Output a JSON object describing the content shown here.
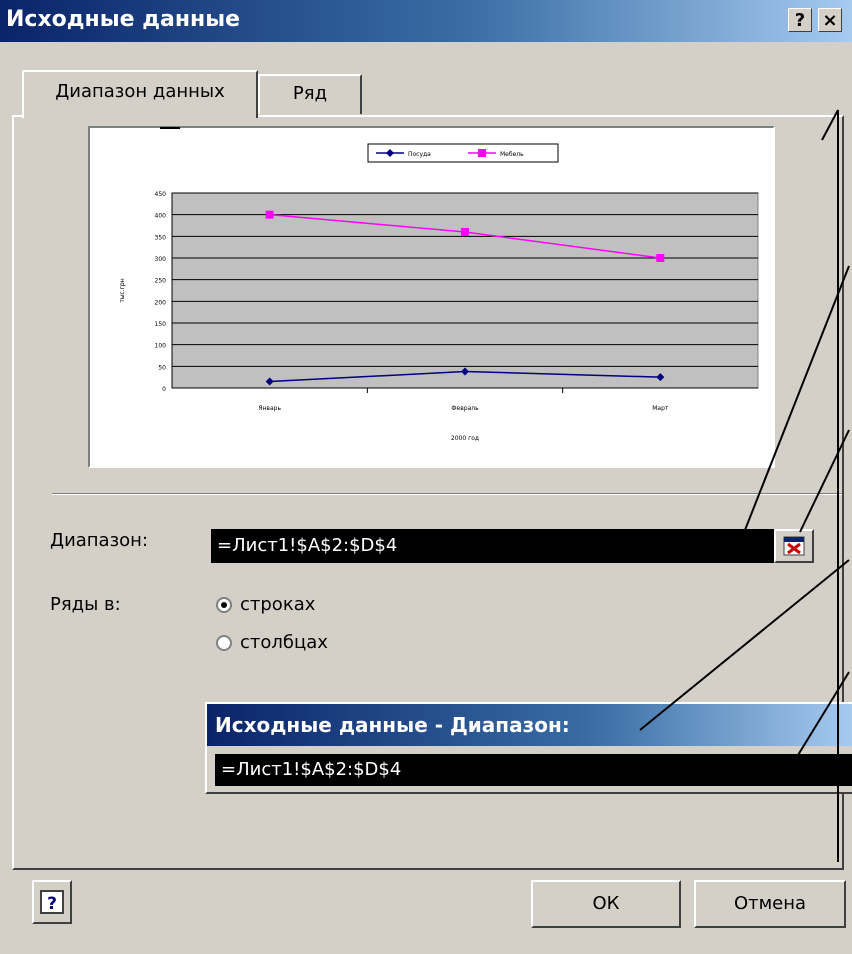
{
  "dialog": {
    "title": "Исходные данные",
    "help_btn": "?",
    "close_btn": "×"
  },
  "tabs": [
    {
      "label": "Диапазон данных",
      "active": true
    },
    {
      "label": "Ряд",
      "active": false
    }
  ],
  "chart_data": {
    "type": "line",
    "categories": [
      "Январь",
      "Февраль",
      "Март"
    ],
    "series": [
      {
        "name": "Посуда",
        "values": [
          15,
          38,
          25
        ],
        "color": "#000080"
      },
      {
        "name": "Мебель",
        "values": [
          400,
          360,
          300
        ],
        "color": "#ff00ff"
      }
    ],
    "xlabel": "2000 год",
    "ylabel": "тыс.грн",
    "ylim": [
      0,
      450
    ],
    "yticks": [
      0,
      50,
      100,
      150,
      200,
      250,
      300,
      350,
      400,
      450
    ],
    "plot_background": "#c0c0c0",
    "legend_position": "top"
  },
  "range": {
    "label": "Диапазон:",
    "value": "=Лист1!$A$2:$D$4"
  },
  "series_in": {
    "label": "Ряды в:",
    "options": [
      {
        "label": "строках",
        "selected": true
      },
      {
        "label": "столбцах",
        "selected": false
      }
    ]
  },
  "collapsed_dialog": {
    "title": "Исходные данные - Диапазон:",
    "value": "=Лист1!$A$2:$D$4"
  },
  "buttons": {
    "help_icon": "?",
    "ok": "ОК",
    "cancel": "Отмена"
  },
  "icons": {
    "range_picker": "range-picker-icon",
    "help": "help-icon"
  }
}
